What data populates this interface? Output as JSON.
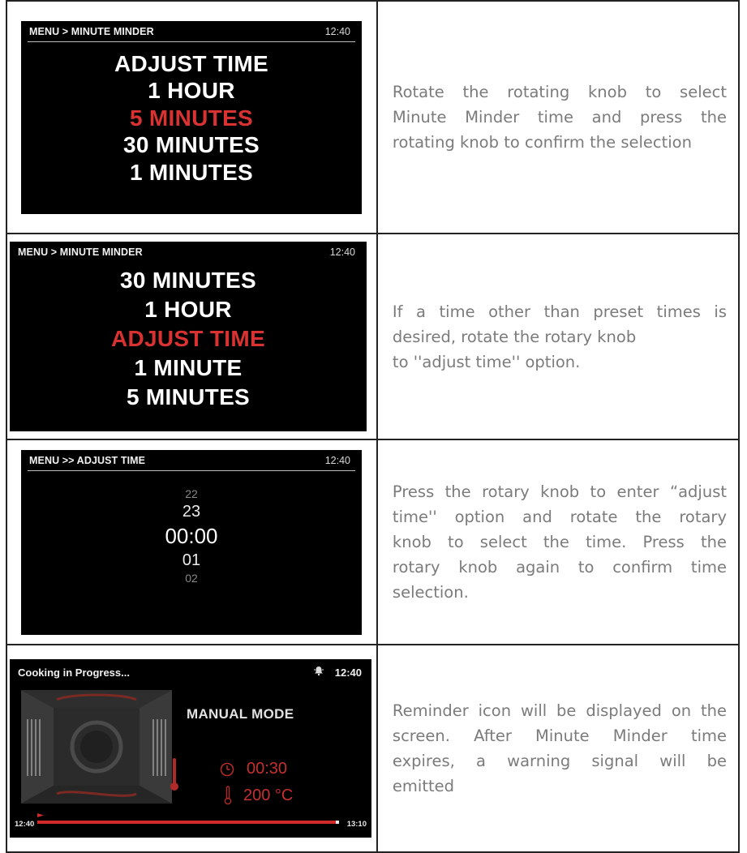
{
  "rows": [
    {
      "screen": {
        "breadcrumb": "MENU > MINUTE MINDER",
        "clock": "12:40",
        "items": [
          "ADJUST TIME",
          "1 HOUR",
          "5 MINUTES",
          "30 MINUTES",
          "1 MINUTES"
        ],
        "selected_index": 2
      },
      "description_lines": [
        "Rotate the rotating knob to select",
        "Minute Minder time and press the",
        "rotating knob to confirm the selection"
      ]
    },
    {
      "screen": {
        "breadcrumb": "MENU > MINUTE MINDER",
        "clock": "12:40",
        "items": [
          "30 MINUTES",
          "1 HOUR",
          "ADJUST TIME",
          "1 MINUTE",
          "5 MINUTES"
        ],
        "selected_index": 2
      },
      "description_lines": [
        "If a time other than preset times is",
        "desired, rotate the rotary knob",
        "to ''adjust time'' option."
      ]
    },
    {
      "screen": {
        "breadcrumb": "MENU >> ADJUST TIME",
        "clock": "12:40",
        "values": [
          "22",
          "23",
          "00:00",
          "01",
          "02"
        ]
      },
      "description_lines": [
        "Press the rotary knob to enter “adjust",
        "time'' option and rotate the rotary",
        "knob to select the time. Press the",
        "rotary knob again to confirm time",
        "selection."
      ]
    },
    {
      "screen": {
        "status": "Cooking in Progress...",
        "clock": "12:40",
        "reminder_icon": "bell-icon",
        "mode": "MANUAL MODE",
        "timer": "00:30",
        "temperature": "200 °C",
        "start_time": "12:40",
        "end_time": "13:10",
        "progress_fraction": 0.99
      },
      "description_lines": [
        "Reminder icon will be displayed on the",
        "screen. After Minute Minder time",
        "expires, a warning signal will be",
        "emitted"
      ]
    }
  ],
  "colors": {
    "selected": "#d93232",
    "text_gray": "#7b7b7b",
    "screen_bg": "#000000"
  }
}
